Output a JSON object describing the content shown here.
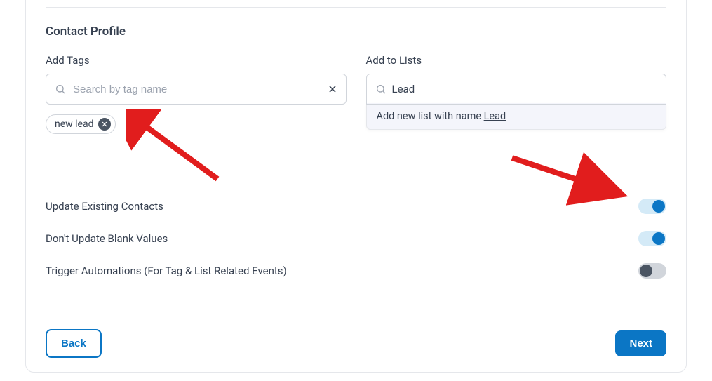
{
  "section_title": "Contact Profile",
  "tags": {
    "label": "Add Tags",
    "placeholder": "Search by tag name",
    "selected": [
      {
        "label": "new lead"
      }
    ]
  },
  "lists": {
    "label": "Add to Lists",
    "value": "Lead",
    "dropdown_prefix": "Add new list with name ",
    "dropdown_value": "Lead"
  },
  "toggles": [
    {
      "label": "Update Existing Contacts",
      "on": true
    },
    {
      "label": "Don't Update Blank Values",
      "on": true
    },
    {
      "label": "Trigger Automations (For Tag & List Related Events)",
      "on": false
    }
  ],
  "buttons": {
    "back": "Back",
    "next": "Next"
  }
}
